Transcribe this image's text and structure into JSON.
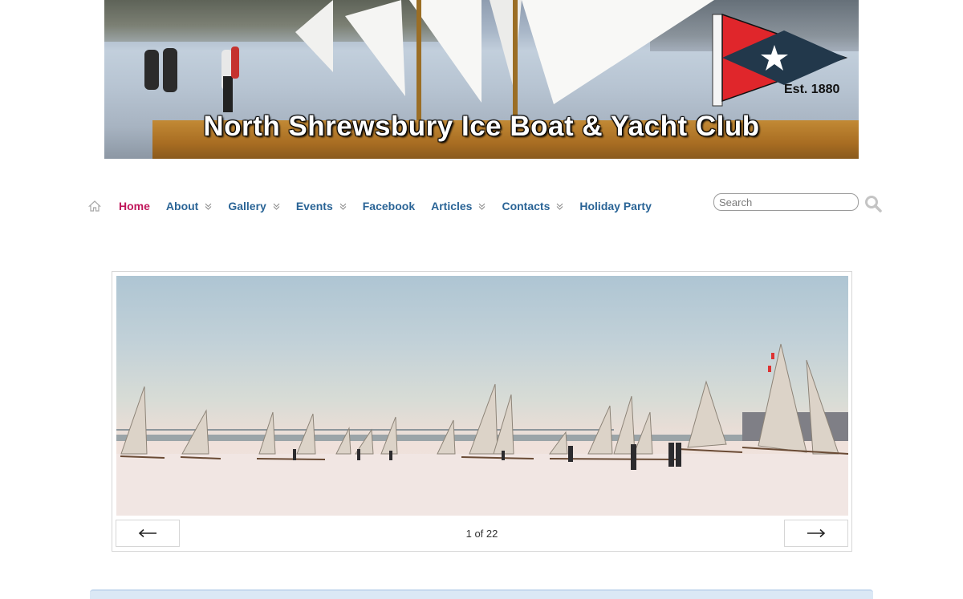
{
  "header": {
    "site_title": "North Shrewsbury Ice Boat & Yacht Club",
    "established": "Est. 1880"
  },
  "nav": {
    "items": [
      {
        "label": "Home",
        "active": true,
        "has_submenu": false
      },
      {
        "label": "About",
        "active": false,
        "has_submenu": true
      },
      {
        "label": "Gallery",
        "active": false,
        "has_submenu": true
      },
      {
        "label": "Events",
        "active": false,
        "has_submenu": true
      },
      {
        "label": "Facebook",
        "active": false,
        "has_submenu": false
      },
      {
        "label": "Articles",
        "active": false,
        "has_submenu": true
      },
      {
        "label": "Contacts",
        "active": false,
        "has_submenu": true
      },
      {
        "label": "Holiday Party",
        "active": false,
        "has_submenu": false
      }
    ]
  },
  "search": {
    "placeholder": "Search",
    "value": ""
  },
  "slideshow": {
    "counter": "1 of 22",
    "current": 1,
    "total": 22,
    "prev_icon": "left-arrow-icon",
    "next_icon": "right-arrow-icon"
  },
  "colors": {
    "nav_link": "#2a6496",
    "nav_active": "#c0175b",
    "burgee_red": "#e0262b",
    "burgee_navy": "#22384b"
  }
}
